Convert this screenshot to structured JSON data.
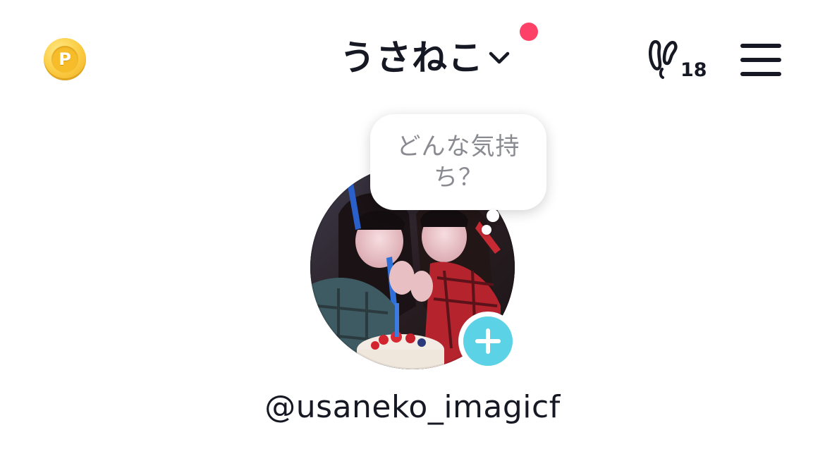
{
  "header": {
    "coin_icon": "coin-icon",
    "coin_letter": "P",
    "account_name": "うさねこ",
    "chevron_icon": "chevron-down-icon",
    "notification_color": "#fe2c55",
    "footprint_icon": "footprints-icon",
    "footprint_count": "18",
    "menu_icon": "hamburger-menu-icon"
  },
  "profile": {
    "mood_prompt": "どんな気持ち？",
    "add_story_icon": "plus-icon",
    "add_story_color": "#5cd2e7",
    "username": "@usaneko_imagicf"
  }
}
